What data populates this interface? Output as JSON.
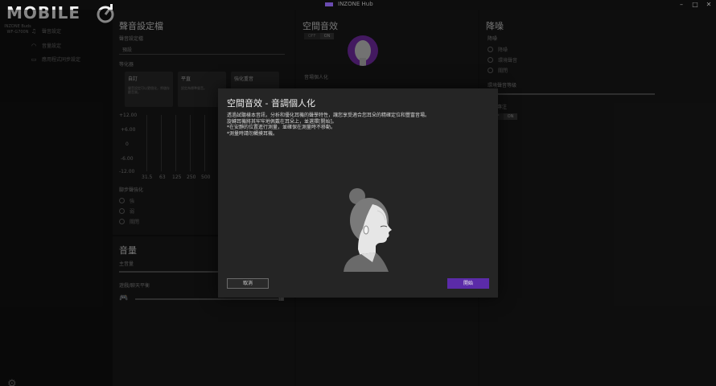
{
  "titlebar": {
    "title": "INZONE Hub",
    "minimize": "–",
    "maximize": "□",
    "close": "✕"
  },
  "brand": {
    "text": "MOBILE"
  },
  "sidebar": {
    "device": "INZONE Buds WF-G700N",
    "items": [
      {
        "icon": "♫",
        "label": "聲音設定"
      },
      {
        "icon": "◠",
        "label": "音量設定"
      },
      {
        "icon": "▭",
        "label": "應用程式同步設定"
      }
    ],
    "settings_icon": "⚙"
  },
  "sound": {
    "title": "聲音設定檔",
    "profile_label": "聲音設定檔",
    "profile_value": "預設",
    "eq_label": "等化器",
    "eq_cards": [
      {
        "title": "自訂",
        "desc": "聲音設定可以更個化，將儲存聽音樂。"
      },
      {
        "title": "平直",
        "desc": "設定為標準聲音。"
      },
      {
        "title": "強化重音",
        "desc": ""
      }
    ],
    "eq_y": [
      "+12.00",
      "+6.00",
      "0",
      "-6.00",
      "-12.00"
    ],
    "eq_x": [
      "31.5",
      "63",
      "125",
      "250",
      "500"
    ],
    "footstep_label": "腳步聲強化",
    "radios": [
      "強",
      "弱",
      "關閉"
    ]
  },
  "volume": {
    "title": "音量",
    "main_label": "主音量",
    "game_chat_label": "遊戲/聊天平衡",
    "game_icon": "🎮",
    "chat_icon": "▦"
  },
  "spatial": {
    "title": "空間音效",
    "toggle_off": "OFF",
    "toggle_on": "ON",
    "personal_label": "音場個人化"
  },
  "nc": {
    "title": "降噪",
    "mode_label": "降噪",
    "radios": [
      "降噪",
      "環境聲音",
      "關閉"
    ],
    "ambient_label": "環境聲音等級",
    "focus_label": "語音專注",
    "toggle_off": "OFF",
    "toggle_on": "ON"
  },
  "dialog": {
    "title": "空間音效 - 音調個人化",
    "lines": [
      "透過試聽樣本音訊，分析和優化耳機的聲學特性，讓您享受適合您耳朵的精確定位和豐富音場。",
      "旋轉耳機將其牢牢地佩戴在耳朵上，並選擇[開始]。",
      "*在安靜的位置進行測量，並確保在測量時不移動。",
      "*測量時請勿觸摸耳機。"
    ],
    "cancel": "取消",
    "start": "開始"
  },
  "colors": {
    "accent": "#5b2ba8",
    "avatar": "#7a2fb0"
  }
}
